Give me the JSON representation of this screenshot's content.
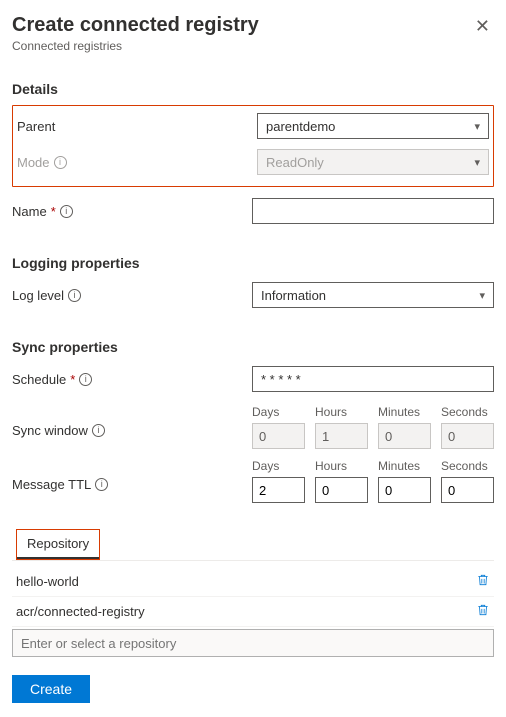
{
  "header": {
    "title": "Create connected registry",
    "subtitle": "Connected registries"
  },
  "sections": {
    "details": "Details",
    "logging": "Logging properties",
    "sync": "Sync properties"
  },
  "labels": {
    "parent": "Parent",
    "mode": "Mode",
    "name": "Name",
    "loglevel": "Log level",
    "schedule": "Schedule",
    "syncwindow": "Sync window",
    "messagettl": "Message TTL",
    "days": "Days",
    "hours": "Hours",
    "minutes": "Minutes",
    "seconds": "Seconds"
  },
  "values": {
    "parent": "parentdemo",
    "mode": "ReadOnly",
    "name": "",
    "loglevel": "Information",
    "schedule": "* * * * *",
    "syncwindow": {
      "days": "0",
      "hours": "1",
      "minutes": "0",
      "seconds": "0"
    },
    "messagettl": {
      "days": "2",
      "hours": "0",
      "minutes": "0",
      "seconds": "0"
    }
  },
  "tabs": {
    "repository": "Repository"
  },
  "repos": {
    "items": [
      "hello-world",
      "acr/connected-registry"
    ],
    "placeholder": "Enter or select a repository"
  },
  "footer": {
    "create": "Create"
  }
}
